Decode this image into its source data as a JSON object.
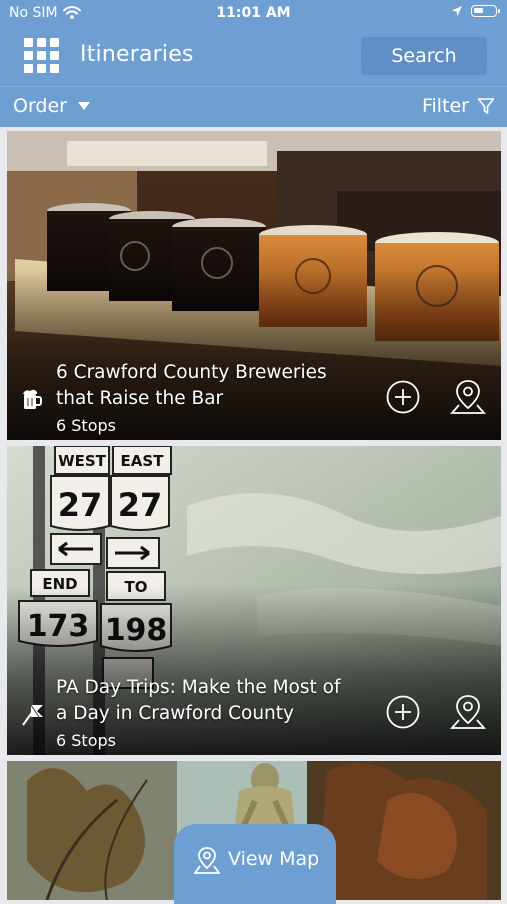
{
  "status_bar": {
    "carrier": "No SIM",
    "time": "11:01 AM"
  },
  "header": {
    "menu_icon": "grid-menu-icon",
    "title": "Itineraries",
    "search_label": "Search"
  },
  "toolbar": {
    "order_label": "Order",
    "filter_label": "Filter"
  },
  "cards": [
    {
      "title": "6 Crawford County Breweries that Raise the Bar",
      "stops": "6 Stops",
      "category_icon": "beer-mug-icon"
    },
    {
      "title": "PA Day Trips: Make the Most of a Day in Crawford County",
      "stops": "6 Stops",
      "category_icon": "flag-icon"
    },
    {
      "title": "",
      "stops": ""
    }
  ],
  "view_map": {
    "label": "View Map"
  },
  "colors": {
    "header_blue": "#6f9fd2",
    "background": "#e7e9ec"
  }
}
